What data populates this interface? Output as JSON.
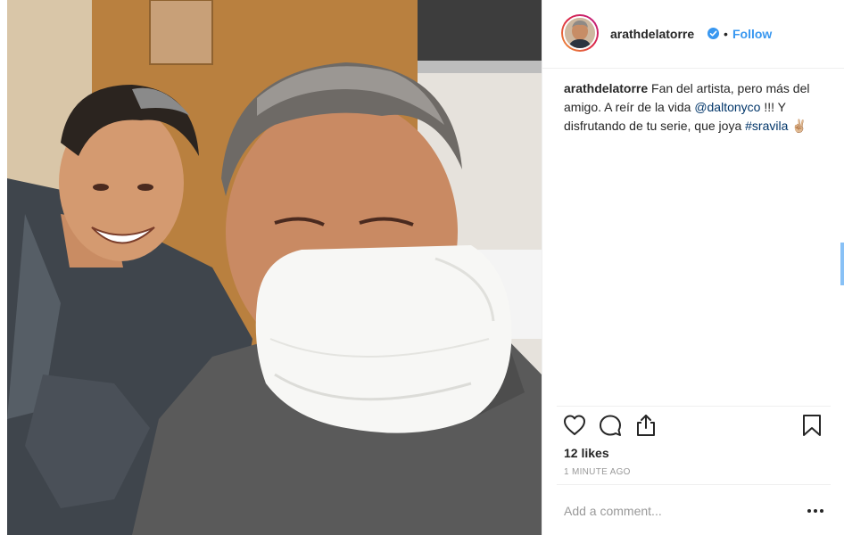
{
  "post": {
    "username": "arathdelatorre",
    "verified": true,
    "follow_label": "Follow",
    "separator": "•",
    "caption": {
      "username": "arathdelatorre",
      "text_1": " Fan del artista, pero más del amigo. A reír de la vida ",
      "mention": "@daltonyco",
      "text_2": " !!! Y disfrutando de tu serie, que joya ",
      "hashtag": "#sravila",
      "emoji": " ✌🏼"
    },
    "likes": "12 likes",
    "timestamp": "1 MINUTE AGO",
    "comment": {
      "placeholder": "Add a comment..."
    }
  },
  "icons": {
    "verified": "verified-badge-icon",
    "like": "heart-icon",
    "comment": "comment-bubble-icon",
    "share": "share-icon",
    "save": "bookmark-icon",
    "more": "more-options-icon"
  },
  "colors": {
    "link_blue": "#3897f0",
    "mention_blue": "#003569",
    "text": "#262626",
    "muted": "#999999",
    "border": "#efefef"
  }
}
